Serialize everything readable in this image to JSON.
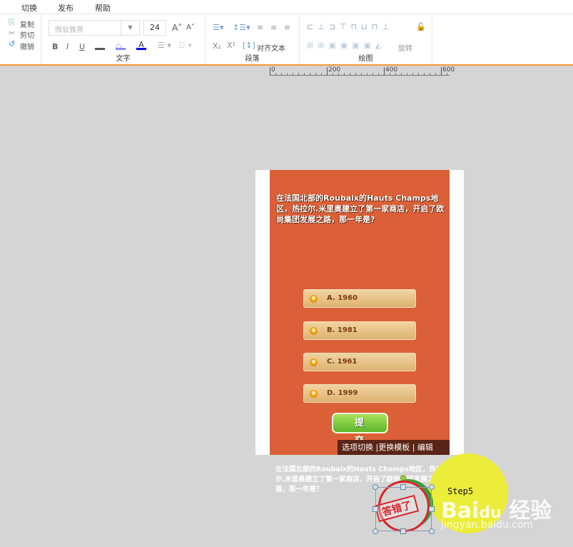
{
  "menu": [
    "切换",
    "发布",
    "帮助"
  ],
  "clipboard": {
    "copy": "复制",
    "cut": "剪切",
    "undo": "撤销"
  },
  "text_group": {
    "label": "文字",
    "font": "微软雅黑",
    "size": "24",
    "bold": "B",
    "italic": "I",
    "underline": "U"
  },
  "para_group": {
    "label": "段落",
    "align_text": "对齐文本"
  },
  "draw_group": {
    "label": "绘图",
    "rotate": "旋转"
  },
  "ruler": [
    "0",
    "200",
    "400",
    "600"
  ],
  "slide": {
    "question": "在法国北部的Roubaix的Hauts Champs地区，热拉尔.米里奥建立了第一家商店，开启了欧尚集团发展之路，那一年是?",
    "options": [
      "A.  1960",
      "B.  1981",
      "C.  1961",
      "D.  1999"
    ],
    "submit": "提 交",
    "edit_bar": "选项切换 |更换模板 | 编辑"
  },
  "caption": "在法国北部的Roubaix的Hauts  Champs地区，热拉尔.米里奥建立了第一家商店，开启了欧尚集团发展之路，那一年是？",
  "stamp": "答错了",
  "step": "Step5",
  "watermark": {
    "logo": "Baidu经验",
    "url": "jingyan.baidu.com"
  }
}
